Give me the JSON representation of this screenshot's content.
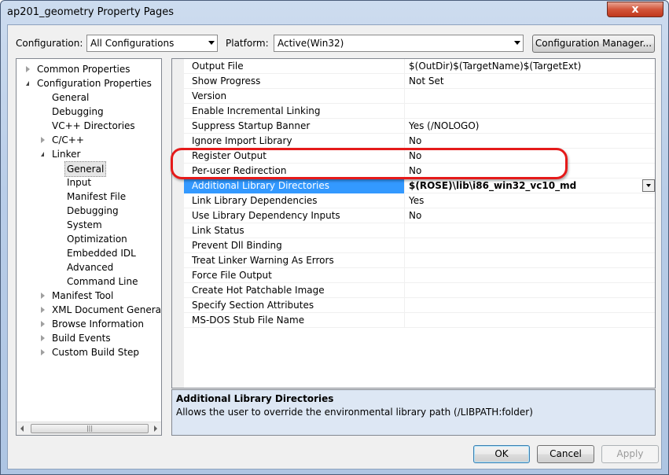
{
  "window": {
    "title": "ap201_geometry Property Pages",
    "close_glyph": "x"
  },
  "toolbar": {
    "configuration_label": "Configuration:",
    "configuration_value": "All Configurations",
    "platform_label": "Platform:",
    "platform_value": "Active(Win32)",
    "config_manager_label": "Configuration Manager..."
  },
  "tree": {
    "items": [
      {
        "label": "Common Properties",
        "level": 0,
        "expander": "collapsed"
      },
      {
        "label": "Configuration Properties",
        "level": 0,
        "expander": "expanded"
      },
      {
        "label": "General",
        "level": 1,
        "expander": "none"
      },
      {
        "label": "Debugging",
        "level": 1,
        "expander": "none"
      },
      {
        "label": "VC++ Directories",
        "level": 1,
        "expander": "none"
      },
      {
        "label": "C/C++",
        "level": 1,
        "expander": "collapsed"
      },
      {
        "label": "Linker",
        "level": 1,
        "expander": "expanded"
      },
      {
        "label": "General",
        "level": 2,
        "expander": "none",
        "selected": true
      },
      {
        "label": "Input",
        "level": 2,
        "expander": "none"
      },
      {
        "label": "Manifest File",
        "level": 2,
        "expander": "none"
      },
      {
        "label": "Debugging",
        "level": 2,
        "expander": "none"
      },
      {
        "label": "System",
        "level": 2,
        "expander": "none"
      },
      {
        "label": "Optimization",
        "level": 2,
        "expander": "none"
      },
      {
        "label": "Embedded IDL",
        "level": 2,
        "expander": "none"
      },
      {
        "label": "Advanced",
        "level": 2,
        "expander": "none"
      },
      {
        "label": "Command Line",
        "level": 2,
        "expander": "none"
      },
      {
        "label": "Manifest Tool",
        "level": 1,
        "expander": "collapsed"
      },
      {
        "label": "XML Document Generator",
        "level": 1,
        "expander": "collapsed"
      },
      {
        "label": "Browse Information",
        "level": 1,
        "expander": "collapsed"
      },
      {
        "label": "Build Events",
        "level": 1,
        "expander": "collapsed"
      },
      {
        "label": "Custom Build Step",
        "level": 1,
        "expander": "collapsed"
      }
    ],
    "scroll_thumb_glyph": "|||"
  },
  "grid": {
    "rows": [
      {
        "name": "Output File",
        "value": "$(OutDir)$(TargetName)$(TargetExt)"
      },
      {
        "name": "Show Progress",
        "value": "Not Set"
      },
      {
        "name": "Version",
        "value": ""
      },
      {
        "name": "Enable Incremental Linking",
        "value": ""
      },
      {
        "name": "Suppress Startup Banner",
        "value": "Yes (/NOLOGO)"
      },
      {
        "name": "Ignore Import Library",
        "value": "No"
      },
      {
        "name": "Register Output",
        "value": "No"
      },
      {
        "name": "Per-user Redirection",
        "value": "No"
      },
      {
        "name": "Additional Library Directories",
        "value": "$(ROSE)\\lib\\i86_win32_vc10_md",
        "selected": true
      },
      {
        "name": "Link Library Dependencies",
        "value": "Yes"
      },
      {
        "name": "Use Library Dependency Inputs",
        "value": "No"
      },
      {
        "name": "Link Status",
        "value": ""
      },
      {
        "name": "Prevent Dll Binding",
        "value": ""
      },
      {
        "name": "Treat Linker Warning As Errors",
        "value": ""
      },
      {
        "name": "Force File Output",
        "value": ""
      },
      {
        "name": "Create Hot Patchable Image",
        "value": ""
      },
      {
        "name": "Specify Section Attributes",
        "value": ""
      },
      {
        "name": "MS-DOS Stub File Name",
        "value": ""
      }
    ]
  },
  "description": {
    "title": "Additional Library Directories",
    "text": "Allows the user to override the environmental library path (/LIBPATH:folder)"
  },
  "buttons": {
    "ok": "OK",
    "cancel": "Cancel",
    "apply": "Apply"
  },
  "colors": {
    "selection": "#3399ff",
    "highlight_ring": "#e51a1a"
  }
}
